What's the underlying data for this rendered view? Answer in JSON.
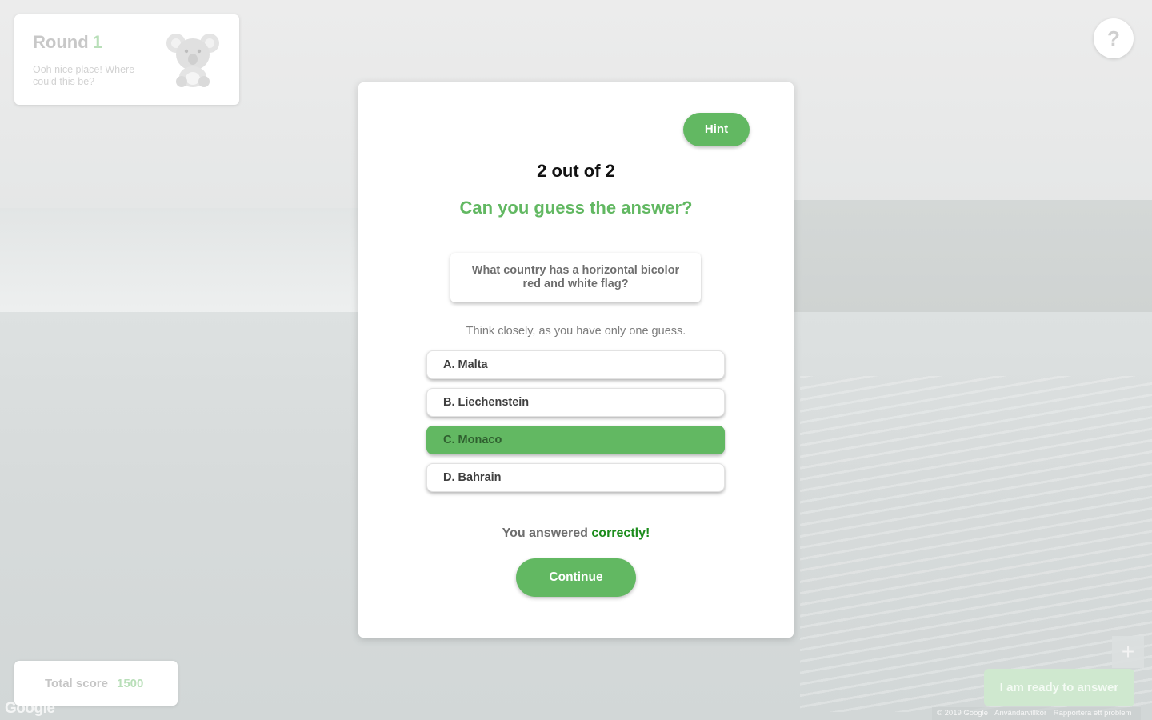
{
  "round_panel": {
    "label": "Round",
    "number": "1",
    "description": "Ooh nice place! Where could this be?"
  },
  "help": {
    "label": "?"
  },
  "modal": {
    "hint_label": "Hint",
    "progress": "2 out of 2",
    "prompt": "Can you guess the answer?",
    "question": "What country has a horizontal bicolor red and white flag?",
    "instruction": "Think closely, as you have only one guess.",
    "options": [
      {
        "label": "A. Malta",
        "selected": false
      },
      {
        "label": "B. Liechenstein",
        "selected": false
      },
      {
        "label": "C. Monaco",
        "selected": true
      },
      {
        "label": "D. Bahrain",
        "selected": false
      }
    ],
    "result_prefix": "You answered",
    "result_word": "correctly!",
    "continue_label": "Continue"
  },
  "score_panel": {
    "label": "Total score",
    "value": "1500"
  },
  "map": {
    "logo": "Google",
    "zoom_label": "+",
    "footer": [
      "© 2019 Google",
      "Användarvillkor",
      "Rapportera ett problem"
    ]
  },
  "ready_button": {
    "label": "I am ready to answer"
  },
  "colors": {
    "accent": "#62b862",
    "correct": "#1b8c1b"
  }
}
